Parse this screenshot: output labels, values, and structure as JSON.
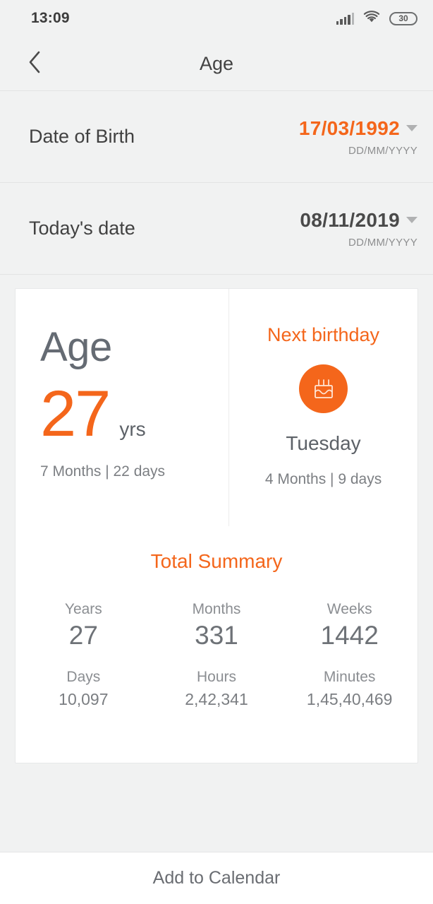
{
  "status_bar": {
    "time": "13:09",
    "battery_level": "30",
    "signal_icon": "signal-bars-icon",
    "wifi_icon": "wifi-icon"
  },
  "header": {
    "back_icon": "chevron-left-icon",
    "title": "Age"
  },
  "rows": [
    {
      "label": "Date of Birth",
      "value": "17/03/1992",
      "format": "DD/MM/YYYY",
      "accent": true
    },
    {
      "label": "Today's date",
      "value": "08/11/2019",
      "format": "DD/MM/YYYY",
      "accent": false
    }
  ],
  "age_card": {
    "age_label": "Age",
    "age_number": "27",
    "age_unit": "yrs",
    "age_detail": "7 Months | 22 days",
    "next_birthday_label": "Next birthday",
    "cake_icon": "birthday-cake-icon",
    "next_birthday_day": "Tuesday",
    "next_birthday_detail": "4 Months | 9 days"
  },
  "summary": {
    "title": "Total Summary",
    "row1": [
      {
        "label": "Years",
        "value": "27"
      },
      {
        "label": "Months",
        "value": "331"
      },
      {
        "label": "Weeks",
        "value": "1442"
      }
    ],
    "row2": [
      {
        "label": "Days",
        "value": "10,097"
      },
      {
        "label": "Hours",
        "value": "2,42,341"
      },
      {
        "label": "Minutes",
        "value": "1,45,40,469"
      }
    ]
  },
  "footer": {
    "add_to_calendar": "Add to Calendar"
  },
  "colors": {
    "accent": "#f4661b",
    "page_background": "#f1f2f2",
    "card_background": "#ffffff",
    "text_primary": "#424242",
    "text_secondary": "#8b8e92"
  }
}
